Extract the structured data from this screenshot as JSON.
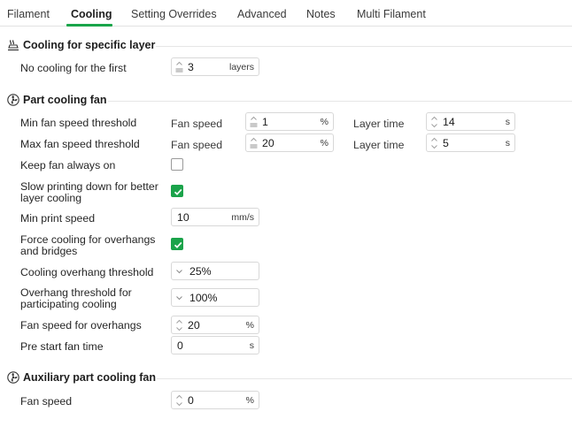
{
  "tabs": [
    "Filament",
    "Cooling",
    "Setting Overrides",
    "Advanced",
    "Notes",
    "Multi Filament"
  ],
  "sections": {
    "layer": {
      "title": "Cooling for specific layer",
      "icon": "layer-cooling-icon"
    },
    "fan": {
      "title": "Part cooling fan",
      "icon": "fan-icon"
    },
    "aux": {
      "title": "Auxiliary part cooling fan",
      "icon": "fan-icon"
    }
  },
  "no_cooling": {
    "label": "No cooling for the first",
    "value": "3",
    "unit": "layers"
  },
  "min_fan": {
    "label": "Min fan speed threshold",
    "fan_label": "Fan speed",
    "fan_value": "1",
    "fan_unit": "%",
    "time_label": "Layer time",
    "time_value": "14",
    "time_unit": "s"
  },
  "max_fan": {
    "label": "Max fan speed threshold",
    "fan_label": "Fan speed",
    "fan_value": "20",
    "fan_unit": "%",
    "time_label": "Layer time",
    "time_value": "5",
    "time_unit": "s"
  },
  "keep_fan": {
    "label": "Keep fan always on",
    "checked": false
  },
  "slow_down": {
    "line1": "Slow printing down for better",
    "line2": "layer cooling",
    "checked": true
  },
  "min_print_speed": {
    "label": "Min print speed",
    "value": "10",
    "unit": "mm/s"
  },
  "force_cooling": {
    "line1": "Force cooling for overhangs",
    "line2": "and bridges",
    "checked": true
  },
  "overhang_threshold": {
    "label": "Cooling overhang threshold",
    "value": "25%"
  },
  "participating": {
    "line1": "Overhang threshold for",
    "line2": "participating cooling",
    "value": "100%"
  },
  "fan_overhangs": {
    "label": "Fan speed for overhangs",
    "value": "20",
    "unit": "%"
  },
  "pre_start": {
    "label": "Pre start fan time",
    "value": "0",
    "unit": "s"
  },
  "aux_fan": {
    "label": "Fan speed",
    "value": "0",
    "unit": "%"
  },
  "colors": {
    "accent": "#1aa34a",
    "border": "#d8d8d8",
    "text": "#262626"
  }
}
